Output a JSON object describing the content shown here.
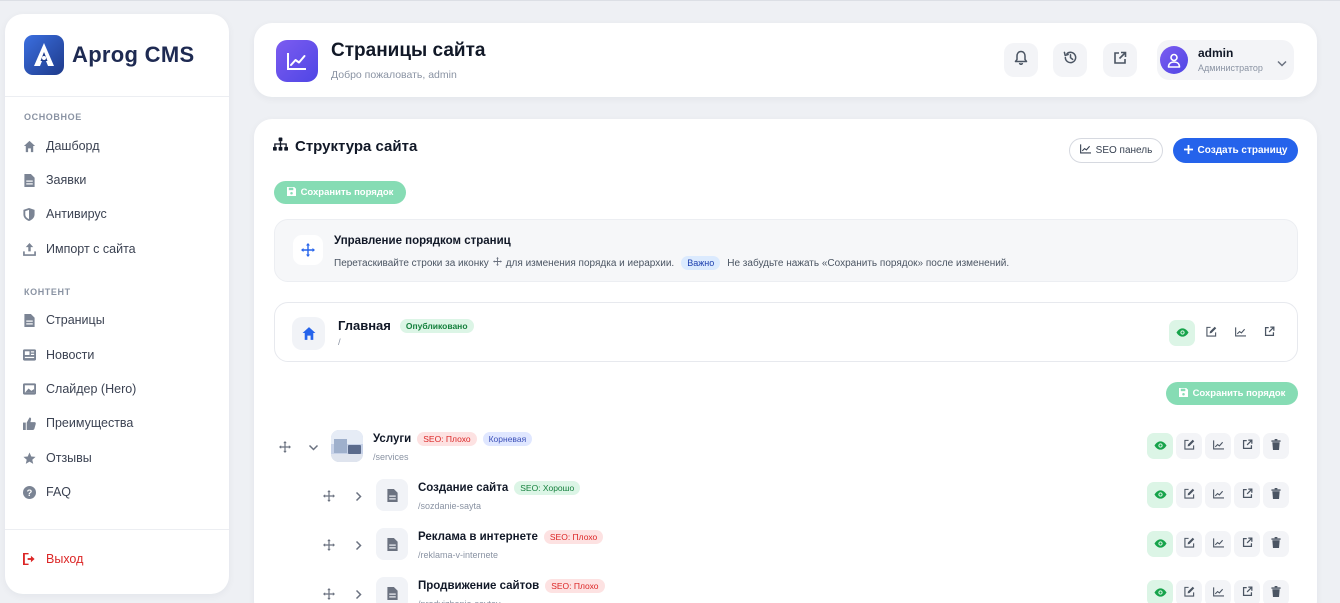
{
  "brand": {
    "name": "Aprog CMS"
  },
  "sidebar": {
    "sections": [
      {
        "title": "ОСНОВНОЕ"
      },
      {
        "title": "КОНТЕНТ"
      }
    ],
    "items": [
      {
        "label": "Дашборд",
        "icon": "home-icon"
      },
      {
        "label": "Заявки",
        "icon": "document-icon"
      },
      {
        "label": "Антивирус",
        "icon": "shield-icon"
      },
      {
        "label": "Импорт с сайта",
        "icon": "upload-icon"
      },
      {
        "label": "Страницы",
        "icon": "document-icon"
      },
      {
        "label": "Новости",
        "icon": "newspaper-icon"
      },
      {
        "label": "Слайдер (Hero)",
        "icon": "image-icon"
      },
      {
        "label": "Преимущества",
        "icon": "thumbs-up-icon"
      },
      {
        "label": "Отзывы",
        "icon": "star-icon"
      },
      {
        "label": "FAQ",
        "icon": "question-icon"
      }
    ],
    "logout": "Выход"
  },
  "header": {
    "title": "Страницы сайта",
    "subtitle": "Добро пожаловать, admin",
    "user": {
      "name": "admin",
      "role": "Администратор"
    }
  },
  "main": {
    "title": "Структура сайта",
    "seo_button": "SEO панель",
    "create_button": "Создать страницу",
    "save_order": "Сохранить порядок",
    "info": {
      "title": "Управление порядком страниц",
      "text_before": "Перетаскивайте строки за иконку",
      "text_middle": "для изменения порядка и иерархии.",
      "badge": "Важно",
      "text_after": "Не забудьте нажать «Сохранить порядок» после изменений."
    },
    "home": {
      "title": "Главная",
      "badge": "Опубликовано",
      "slug": "/"
    },
    "pages": [
      {
        "title": "Услуги",
        "slug": "/services",
        "seo": "SEO: Плохо",
        "seo_status": "bad",
        "extra_badge": "Корневая"
      },
      {
        "title": "Создание сайта",
        "slug": "/sozdanie-sayta",
        "seo": "SEO: Хорошо",
        "seo_status": "good"
      },
      {
        "title": "Реклама в интернете",
        "slug": "/reklama-v-internete",
        "seo": "SEO: Плохо",
        "seo_status": "bad"
      },
      {
        "title": "Продвижение сайтов",
        "slug": "/prodvizhenie-saytov",
        "seo": "SEO: Плохо",
        "seo_status": "bad"
      }
    ]
  },
  "colors": {
    "accent": "#2563eb",
    "save": "#86dcb4",
    "danger": "#dc2626",
    "success": "#16a34a"
  }
}
